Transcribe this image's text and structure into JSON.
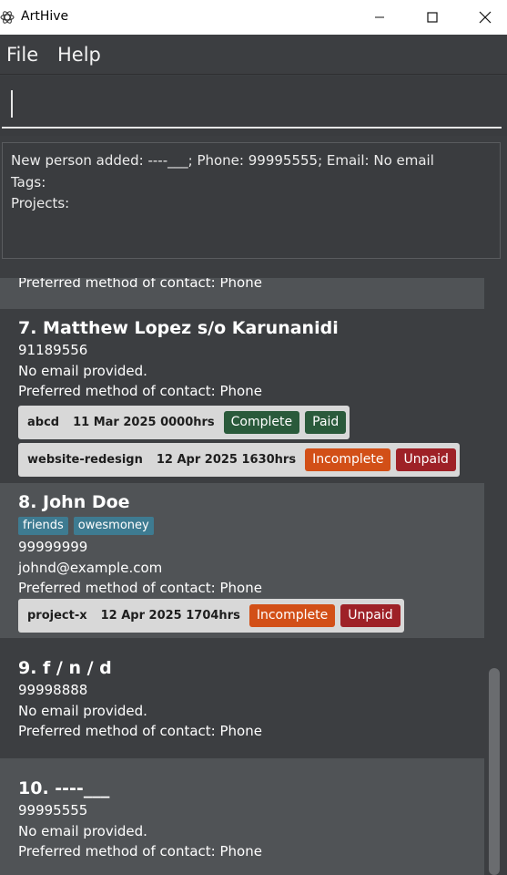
{
  "window": {
    "title": "ArtHive",
    "minimize_icon": "minimize-icon",
    "maximize_icon": "maximize-icon",
    "close_icon": "close-icon"
  },
  "menu": {
    "file": "File",
    "help": "Help"
  },
  "command": {
    "value": "",
    "placeholder": ""
  },
  "result": {
    "line1": "New person added: ----___; Phone: 99995555; Email: No email",
    "line2": "Tags:",
    "line3": "Projects:"
  },
  "persons": {
    "p6": {
      "contact": "Preferred method of contact: Phone"
    },
    "p7": {
      "name": "7.  Matthew Lopez s/o Karunanidi",
      "phone": "91189556",
      "email": "No email provided.",
      "contact": "Preferred method of contact: Phone",
      "projects": [
        {
          "name": "abcd",
          "deadline": "11 Mar 2025 0000hrs",
          "status": "Complete",
          "payment": "Paid"
        },
        {
          "name": "website-redesign",
          "deadline": "12 Apr 2025 1630hrs",
          "status": "Incomplete",
          "payment": "Unpaid"
        }
      ]
    },
    "p8": {
      "name": "8.  John Doe",
      "tags": [
        "friends",
        "owesmoney"
      ],
      "phone": "99999999",
      "email": "johnd@example.com",
      "contact": "Preferred method of contact: Phone",
      "projects": [
        {
          "name": "project-x",
          "deadline": "12 Apr 2025 1704hrs",
          "status": "Incomplete",
          "payment": "Unpaid"
        }
      ]
    },
    "p9": {
      "name": "9.  f / n / d",
      "phone": "99998888",
      "email": "No email provided.",
      "contact": "Preferred method of contact: Phone"
    },
    "p10": {
      "name": "10.  ----___",
      "phone": "99995555",
      "email": "No email provided.",
      "contact": "Preferred method of contact: Phone"
    }
  },
  "colors": {
    "background": "#3c3e41",
    "card_light": "#505356",
    "tag": "#3e7b91",
    "complete": "#2a5a3b",
    "incomplete": "#d24f17",
    "unpaid": "#9e2127"
  }
}
